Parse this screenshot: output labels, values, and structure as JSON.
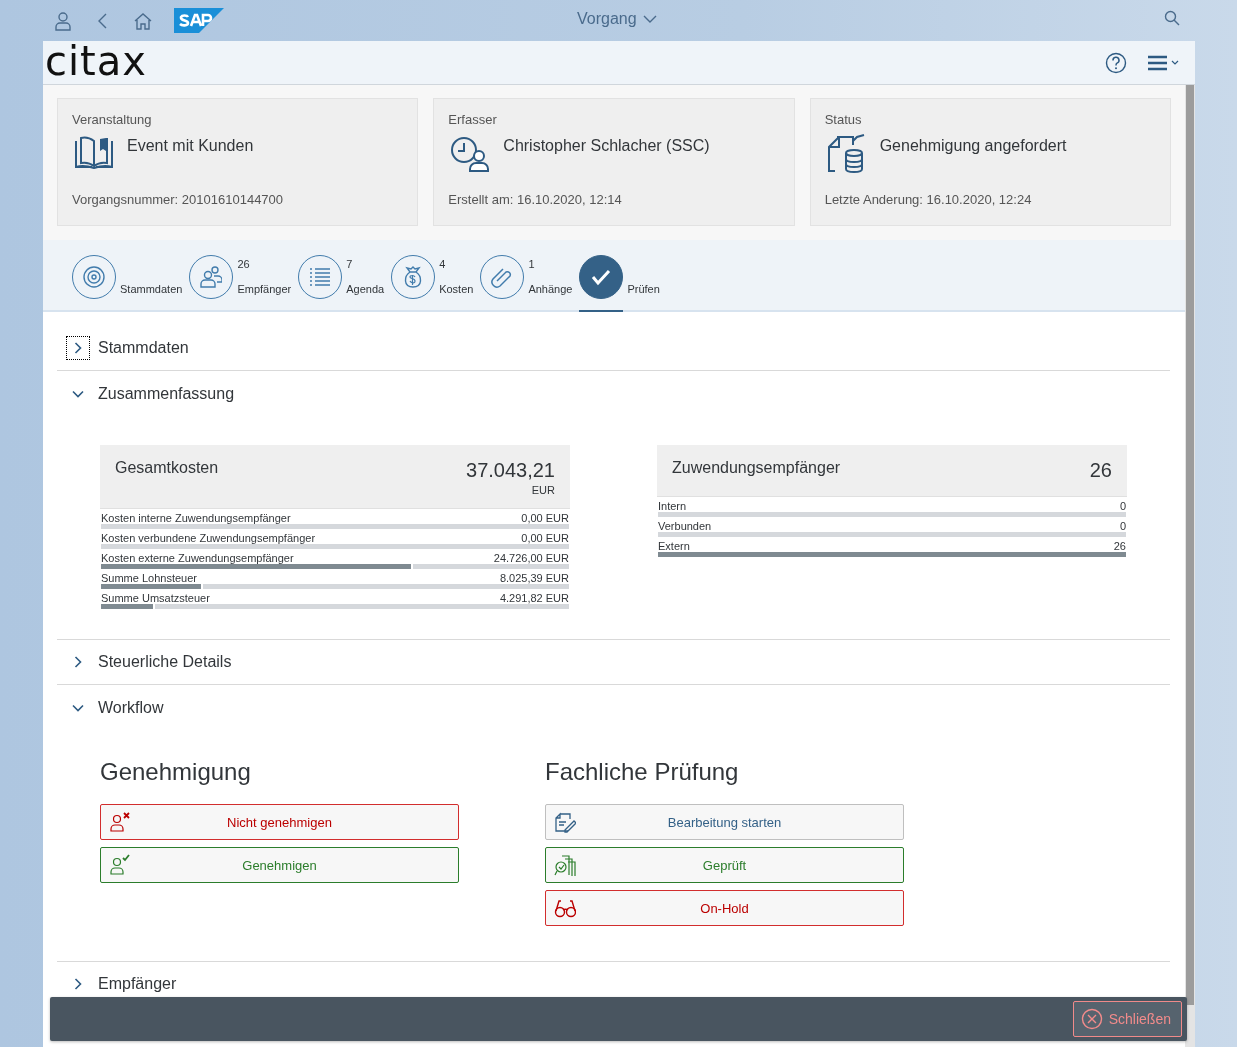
{
  "shell": {
    "title": "Vorgang"
  },
  "app": {
    "logo": "citax"
  },
  "header_cards": [
    {
      "label": "Veranstaltung",
      "value": "Event mit Kunden",
      "footer": "Vorgangsnummer: 20101610144700"
    },
    {
      "label": "Erfasser",
      "value": "Christopher Schlacher (SSC)",
      "footer": "Erstellt am: 16.10.2020, 12:14"
    },
    {
      "label": "Status",
      "value": "Genehmigung angefordert",
      "footer": "Letzte Anderung: 16.10.2020, 12:24"
    }
  ],
  "nav": [
    {
      "label": "Stammdaten",
      "selected": false
    },
    {
      "count": "26",
      "label": "Empfänger",
      "selected": false
    },
    {
      "count": "7",
      "label": "Agenda",
      "selected": false
    },
    {
      "count": "4",
      "label": "Kosten",
      "selected": false
    },
    {
      "count": "1",
      "label": "Anhänge",
      "selected": false
    },
    {
      "label": "Prüfen",
      "selected": true
    }
  ],
  "sections": [
    {
      "title": "Stammdaten",
      "expanded": false,
      "focused": true
    },
    {
      "title": "Zusammenfassung",
      "expanded": true,
      "focused": false,
      "summary": {
        "tiles": [
          {
            "title": "Gesamtkosten",
            "total": "37.043,21",
            "unit": "EUR",
            "rows": [
              {
                "label": "Kosten interne Zuwendungsempfänger",
                "value": "0,00 EUR",
                "level": 0
              },
              {
                "label": "Kosten verbundene Zuwendungsempfänger",
                "value": "0,00 EUR",
                "level": 0
              },
              {
                "label": "Kosten externe Zuwendungsempfänger",
                "value": "24.726,00 EUR",
                "level": 0.667
              },
              {
                "label": "Summe Lohnsteuer",
                "value": "8.025,39 EUR",
                "level": 0.217
              },
              {
                "label": "Summe Umsatzsteuer",
                "value": "4.291,82 EUR",
                "level": 0.116
              }
            ]
          },
          {
            "title": "Zuwendungsempfänger",
            "total": "26",
            "rows": [
              {
                "label": "Intern",
                "value": "0",
                "level": 0
              },
              {
                "label": "Verbunden",
                "value": "0",
                "level": 0
              },
              {
                "label": "Extern",
                "value": "26",
                "level": 1
              }
            ]
          }
        ]
      }
    },
    {
      "title": "Steuerliche Details",
      "expanded": false,
      "focused": false
    },
    {
      "title": "Workflow",
      "expanded": true,
      "focused": false,
      "workflow": {
        "groups": [
          {
            "title": "Genehmigung",
            "buttons": [
              {
                "label": "Nicht genehmigen",
                "kind": "negative"
              },
              {
                "label": "Genehmigen",
                "kind": "positive"
              }
            ]
          },
          {
            "title": "Fachliche Prüfung",
            "buttons": [
              {
                "label": "Bearbeitung starten",
                "kind": "neutral"
              },
              {
                "label": "Geprüft",
                "kind": "positive"
              },
              {
                "label": "On-Hold",
                "kind": "negative"
              }
            ]
          }
        ]
      }
    },
    {
      "title": "Empfänger",
      "expanded": false,
      "focused": false
    }
  ],
  "footer": {
    "buttons": [
      {
        "label": "Schließen"
      }
    ]
  }
}
